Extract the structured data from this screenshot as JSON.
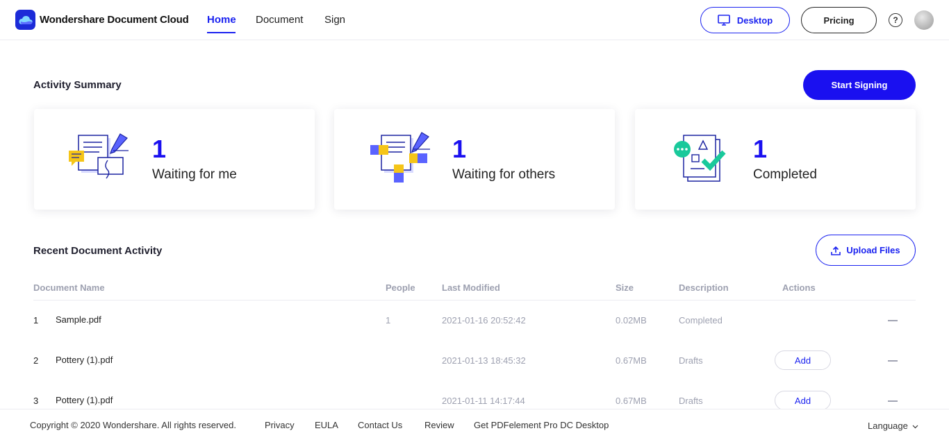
{
  "header": {
    "brand": "Wondershare Document Cloud",
    "nav": [
      "Home",
      "Document",
      "Sign"
    ],
    "active_nav": "Home",
    "desktop_label": "Desktop",
    "pricing_label": "Pricing",
    "help_icon": "?"
  },
  "activity": {
    "title": "Activity Summary",
    "start_signing": "Start Signing",
    "cards": [
      {
        "count": "1",
        "label": "Waiting for me",
        "icon": "sign-pen-document-icon"
      },
      {
        "count": "1",
        "label": "Waiting for others",
        "icon": "hands-document-icon"
      },
      {
        "count": "1",
        "label": "Completed",
        "icon": "completed-check-document-icon"
      }
    ]
  },
  "recent": {
    "title": "Recent Document Activity",
    "upload_label": "Upload Files",
    "columns": [
      "Document Name",
      "People",
      "Last Modified",
      "Size",
      "Description",
      "Actions"
    ],
    "rows": [
      {
        "index": "1",
        "name": "Sample.pdf",
        "people": "1",
        "modified": "2021-01-16 20:52:42",
        "size": "0.02MB",
        "description": "Completed",
        "action": ""
      },
      {
        "index": "2",
        "name": "Pottery (1).pdf",
        "people": "",
        "modified": "2021-01-13 18:45:32",
        "size": "0.67MB",
        "description": "Drafts",
        "action": "Add"
      },
      {
        "index": "3",
        "name": "Pottery (1).pdf",
        "people": "",
        "modified": "2021-01-11 14:17:44",
        "size": "0.67MB",
        "description": "Drafts",
        "action": "Add"
      }
    ]
  },
  "footer": {
    "copyright": "Copyright © 2020 Wondershare. All rights reserved.",
    "links": [
      "Privacy",
      "EULA",
      "Contact Us",
      "Review",
      "Get PDFelement Pro DC Desktop"
    ],
    "language": "Language"
  },
  "colors": {
    "accent": "#1a10f0",
    "muted": "#9da0b0",
    "highlight_yellow": "#f5c518",
    "success_green": "#19c99b"
  }
}
